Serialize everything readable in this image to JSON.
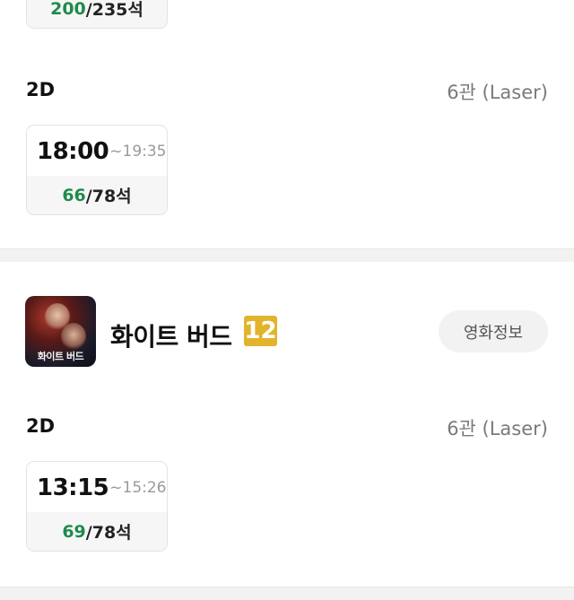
{
  "prev_session": {
    "seats_available": "200",
    "seats_total": "/235석"
  },
  "session_a": {
    "format": "2D",
    "screen": "6관 (Laser)",
    "start": "18:00",
    "end": "~19:35",
    "seats_available": "66",
    "seats_total": "/78석"
  },
  "movie": {
    "title": "화이트 버드",
    "rating": "12",
    "poster_title": "화이트 버드",
    "info_button": "영화정보"
  },
  "session_b": {
    "format": "2D",
    "screen": "6관 (Laser)",
    "start": "13:15",
    "end": "~15:26",
    "seats_available": "69",
    "seats_total": "/78석"
  },
  "colors": {
    "seats_green": "#1f8a4c",
    "rating_badge": "#e2b42c"
  }
}
